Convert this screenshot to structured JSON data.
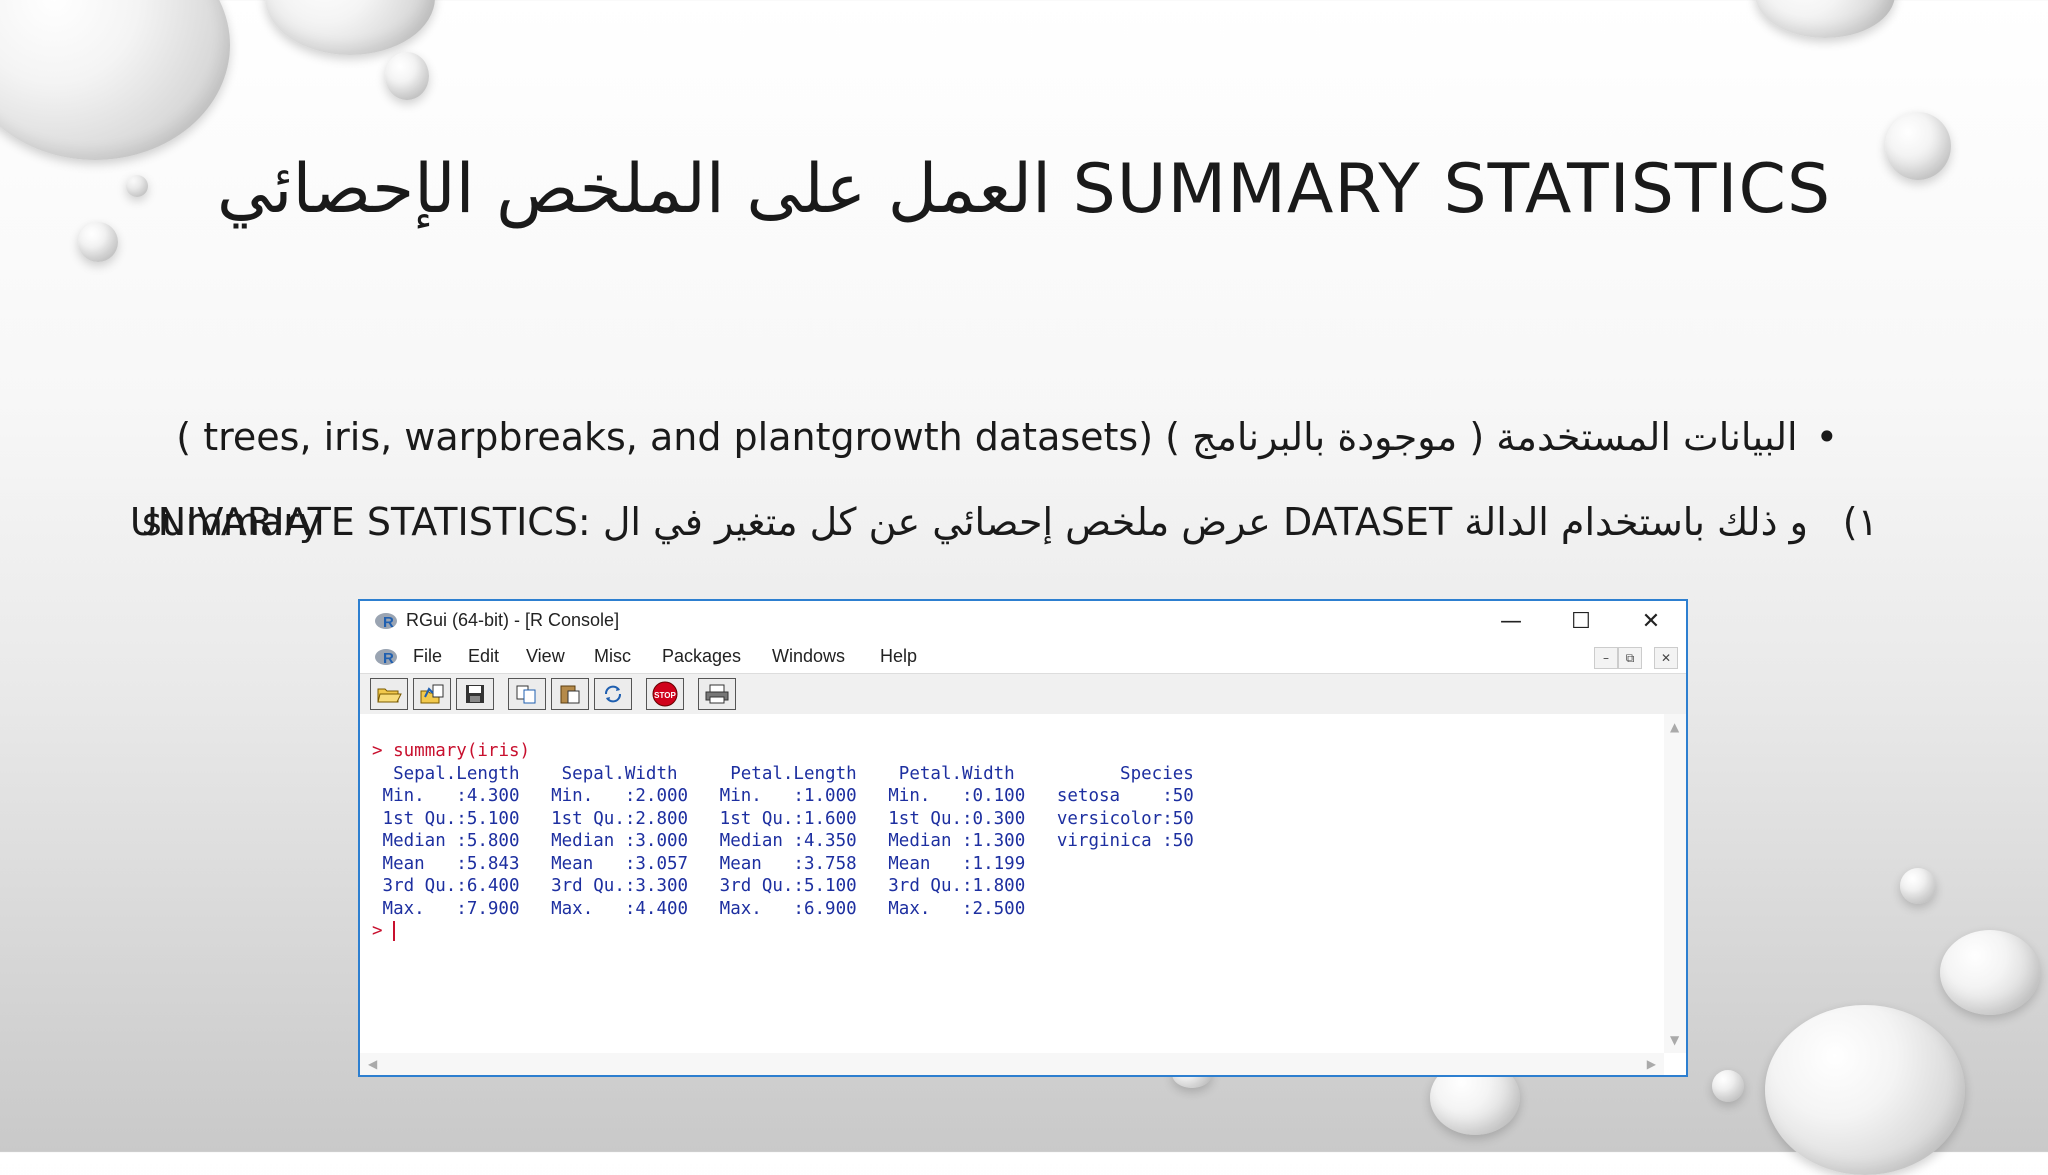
{
  "slide": {
    "title": "العمل على الملخص الإحصائي SUMMARY STATISTICS",
    "bullet1_text": "البيانات المستخدمة ( موجودة بالبرنامج ) (trees, iris, warpbreaks, and plantgrowth datasets )",
    "line2_number": "(١",
    "line2_right": "UNIVARIATE STATISTICS: عرض ملخص إحصائي عن كل متغير في ال DATASET و ذلك باستخدام الدالة",
    "line2_left": "summary"
  },
  "window": {
    "title": "RGui (64-bit) - [R Console]",
    "minimize_glyph": "—",
    "maximize_glyph": "☐",
    "close_glyph": "✕",
    "menu": [
      "File",
      "Edit",
      "View",
      "Misc",
      "Packages",
      "Windows",
      "Help"
    ],
    "mdi_buttons": [
      "–",
      "⧉",
      "✕"
    ],
    "toolbar_icons": [
      "open-script-icon",
      "load-workspace-icon",
      "save-workspace-icon",
      "copy-icon",
      "paste-icon",
      "copy-paste-icon",
      "stop-icon",
      "print-icon"
    ],
    "stop_label": "STOP"
  },
  "console": {
    "prompt": ">",
    "command": "summary(iris)",
    "output_lines": [
      "  Sepal.Length    Sepal.Width     Petal.Length    Petal.Width          Species  ",
      " Min.   :4.300   Min.   :2.000   Min.   :1.000   Min.   :0.100   setosa    :50  ",
      " 1st Qu.:5.100   1st Qu.:2.800   1st Qu.:1.600   1st Qu.:0.300   versicolor:50  ",
      " Median :5.800   Median :3.000   Median :4.350   Median :1.300   virginica :50  ",
      " Mean   :5.843   Mean   :3.057   Mean   :3.758   Mean   :1.199                  ",
      " 3rd Qu.:6.400   3rd Qu.:3.300   3rd Qu.:5.100   3rd Qu.:1.800                  ",
      " Max.   :7.900   Max.   :4.400   Max.   :6.900   Max.   :2.500                  "
    ],
    "final_prompt": ">"
  },
  "colors": {
    "window_border": "#2d7fd0",
    "console_text": "#1d2fa0",
    "command_text": "#c8102e"
  }
}
